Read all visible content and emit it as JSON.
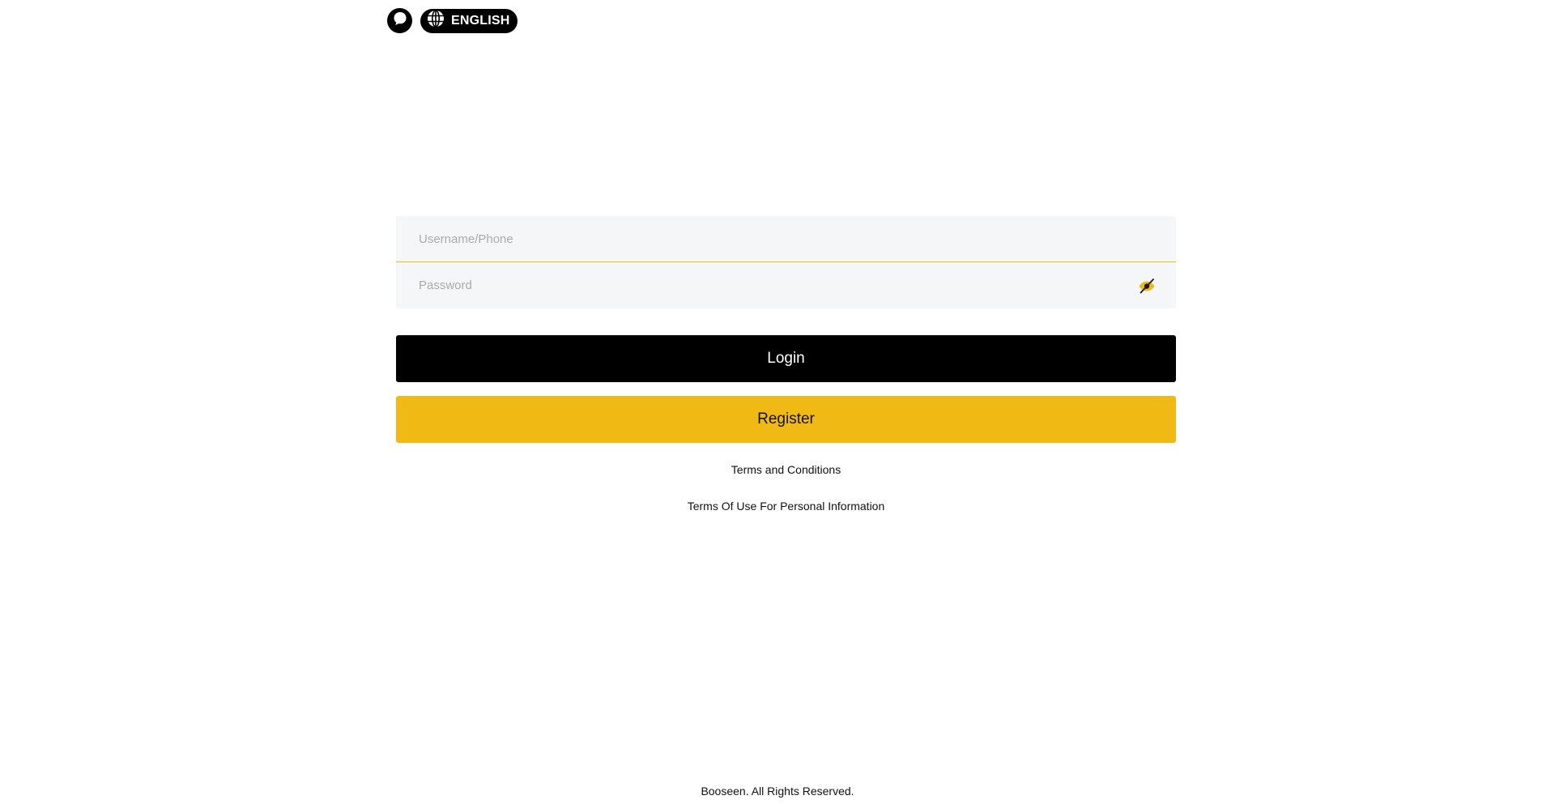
{
  "header": {
    "support_icon": "chat-bubble-icon",
    "language_icon": "globe-icon",
    "language_label": "ENGLISH"
  },
  "form": {
    "username_placeholder": "Username/Phone",
    "username_value": "",
    "password_placeholder": "Password",
    "password_value": "",
    "password_toggle_icon": "eye-slash-icon",
    "login_label": "Login",
    "register_label": "Register"
  },
  "links": {
    "terms": "Terms and Conditions",
    "privacy": "Terms Of Use For Personal Information"
  },
  "footer": {
    "copyright": "Booseen. All Rights Reserved."
  },
  "colors": {
    "accent": "#f1b913",
    "primary_button": "#000000",
    "field_background": "#f5f6f7"
  }
}
